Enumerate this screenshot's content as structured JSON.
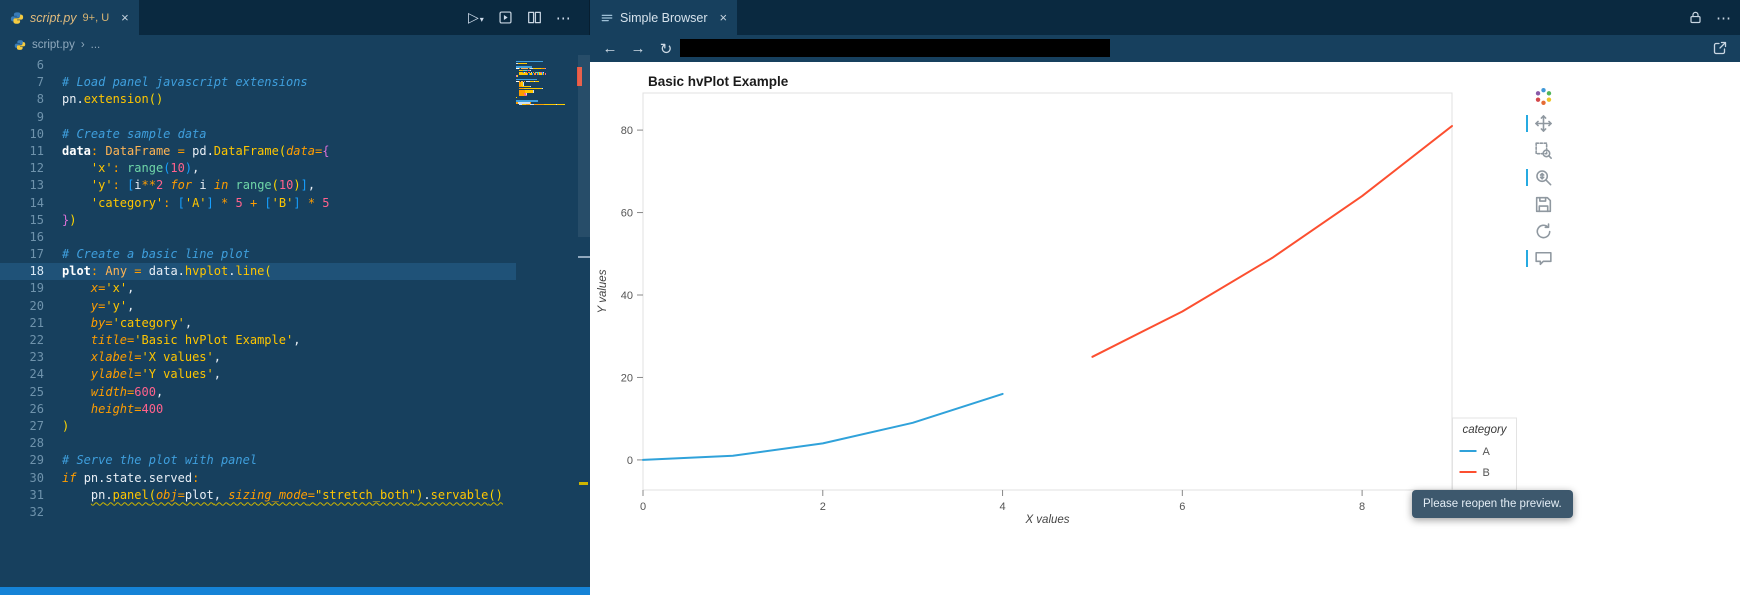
{
  "tabs": {
    "left": {
      "filename": "script.py",
      "decoration": "9+, U"
    },
    "right": {
      "label": "Simple Browser"
    }
  },
  "icons": {
    "play": "▷",
    "chevron_down": "▾",
    "close": "×",
    "more": "⋯",
    "back": "←",
    "forward": "→",
    "reload": "↻"
  },
  "breadcrumb": {
    "file": "script.py",
    "sep": "›",
    "more": "..."
  },
  "tooltip": {
    "message": "Please reopen the preview."
  },
  "bokeh_toolbar": {
    "active_tools": [
      "pan",
      "wheel-zoom",
      "hover"
    ],
    "active_color": "#26aae1"
  },
  "editor": {
    "lines": [
      {
        "n": 6,
        "tokens": []
      },
      {
        "n": 7,
        "tokens": [
          [
            "# Load panel javascript extensions",
            "com"
          ]
        ]
      },
      {
        "n": 8,
        "tokens": [
          [
            "pn",
            "pl"
          ],
          [
            ".",
            "pl"
          ],
          [
            "extension",
            "fn"
          ],
          [
            "()",
            "b1"
          ]
        ]
      },
      {
        "n": 9,
        "tokens": []
      },
      {
        "n": 10,
        "tokens": [
          [
            "# Create sample data",
            "com"
          ]
        ]
      },
      {
        "n": 11,
        "tokens": [
          [
            "data",
            "decl"
          ],
          [
            ":",
            "op"
          ],
          [
            " ",
            "pl"
          ],
          [
            "DataFrame",
            "typ"
          ],
          [
            " ",
            "pl"
          ],
          [
            "=",
            "op"
          ],
          [
            " ",
            "pl"
          ],
          [
            "pd",
            "pl"
          ],
          [
            ".",
            "pl"
          ],
          [
            "DataFrame",
            "fn"
          ],
          [
            "(",
            "b1"
          ],
          [
            "data",
            "prm"
          ],
          [
            "=",
            "op"
          ],
          [
            "{",
            "b2"
          ]
        ]
      },
      {
        "n": 12,
        "tokens": [
          [
            "    ",
            "pl"
          ],
          [
            "'x'",
            "str"
          ],
          [
            ":",
            "op"
          ],
          [
            " ",
            "pl"
          ],
          [
            "range",
            "bi"
          ],
          [
            "(",
            "b3"
          ],
          [
            "10",
            "num"
          ],
          [
            ")",
            "b3"
          ],
          [
            ",",
            "pl"
          ]
        ]
      },
      {
        "n": 13,
        "tokens": [
          [
            "    ",
            "pl"
          ],
          [
            "'y'",
            "str"
          ],
          [
            ":",
            "op"
          ],
          [
            " ",
            "pl"
          ],
          [
            "[",
            "b3"
          ],
          [
            "i",
            "pl"
          ],
          [
            "**",
            "op"
          ],
          [
            "2",
            "num"
          ],
          [
            " ",
            "pl"
          ],
          [
            "for",
            "kw"
          ],
          [
            " ",
            "pl"
          ],
          [
            "i",
            "pl"
          ],
          [
            " ",
            "pl"
          ],
          [
            "in",
            "kw"
          ],
          [
            " ",
            "pl"
          ],
          [
            "range",
            "bi"
          ],
          [
            "(",
            "b1"
          ],
          [
            "10",
            "num"
          ],
          [
            ")",
            "b1"
          ],
          [
            "]",
            "b3"
          ],
          [
            ",",
            "pl"
          ]
        ]
      },
      {
        "n": 14,
        "tokens": [
          [
            "    ",
            "pl"
          ],
          [
            "'category'",
            "str"
          ],
          [
            ":",
            "op"
          ],
          [
            " ",
            "pl"
          ],
          [
            "[",
            "b3"
          ],
          [
            "'A'",
            "str"
          ],
          [
            "]",
            "b3"
          ],
          [
            " ",
            "pl"
          ],
          [
            "*",
            "op"
          ],
          [
            " ",
            "pl"
          ],
          [
            "5",
            "num"
          ],
          [
            " ",
            "pl"
          ],
          [
            "+",
            "op"
          ],
          [
            " ",
            "pl"
          ],
          [
            "[",
            "b3"
          ],
          [
            "'B'",
            "str"
          ],
          [
            "]",
            "b3"
          ],
          [
            " ",
            "pl"
          ],
          [
            "*",
            "op"
          ],
          [
            " ",
            "pl"
          ],
          [
            "5",
            "num"
          ]
        ]
      },
      {
        "n": 15,
        "tokens": [
          [
            "}",
            "b2"
          ],
          [
            ")",
            "b1"
          ]
        ]
      },
      {
        "n": 16,
        "tokens": []
      },
      {
        "n": 17,
        "tokens": [
          [
            "# Create a basic line plot",
            "com"
          ]
        ]
      },
      {
        "n": 18,
        "hl": true,
        "tokens": [
          [
            "plot",
            "decl"
          ],
          [
            ":",
            "op"
          ],
          [
            " ",
            "pl"
          ],
          [
            "Any",
            "typ"
          ],
          [
            " ",
            "pl"
          ],
          [
            "=",
            "op"
          ],
          [
            " ",
            "pl"
          ],
          [
            "data",
            "pl"
          ],
          [
            ".",
            "pl"
          ],
          [
            "hvplot",
            "fn"
          ],
          [
            ".",
            "pl"
          ],
          [
            "line",
            "fn"
          ],
          [
            "(",
            "b1"
          ]
        ]
      },
      {
        "n": 19,
        "tokens": [
          [
            "    ",
            "pl"
          ],
          [
            "x",
            "prm"
          ],
          [
            "=",
            "op"
          ],
          [
            "'x'",
            "str"
          ],
          [
            ",",
            "pl"
          ]
        ]
      },
      {
        "n": 20,
        "tokens": [
          [
            "    ",
            "pl"
          ],
          [
            "y",
            "prm"
          ],
          [
            "=",
            "op"
          ],
          [
            "'y'",
            "str"
          ],
          [
            ",",
            "pl"
          ]
        ]
      },
      {
        "n": 21,
        "tokens": [
          [
            "    ",
            "pl"
          ],
          [
            "by",
            "prm"
          ],
          [
            "=",
            "op"
          ],
          [
            "'category'",
            "str"
          ],
          [
            ",",
            "pl"
          ]
        ]
      },
      {
        "n": 22,
        "tokens": [
          [
            "    ",
            "pl"
          ],
          [
            "title",
            "prm"
          ],
          [
            "=",
            "op"
          ],
          [
            "'Basic hvPlot Example'",
            "str"
          ],
          [
            ",",
            "pl"
          ]
        ]
      },
      {
        "n": 23,
        "tokens": [
          [
            "    ",
            "pl"
          ],
          [
            "xlabel",
            "prm"
          ],
          [
            "=",
            "op"
          ],
          [
            "'X values'",
            "str"
          ],
          [
            ",",
            "pl"
          ]
        ]
      },
      {
        "n": 24,
        "tokens": [
          [
            "    ",
            "pl"
          ],
          [
            "ylabel",
            "prm"
          ],
          [
            "=",
            "op"
          ],
          [
            "'Y values'",
            "str"
          ],
          [
            ",",
            "pl"
          ]
        ]
      },
      {
        "n": 25,
        "tokens": [
          [
            "    ",
            "pl"
          ],
          [
            "width",
            "prm"
          ],
          [
            "=",
            "op"
          ],
          [
            "600",
            "num"
          ],
          [
            ",",
            "pl"
          ]
        ]
      },
      {
        "n": 26,
        "tokens": [
          [
            "    ",
            "pl"
          ],
          [
            "height",
            "prm"
          ],
          [
            "=",
            "op"
          ],
          [
            "400",
            "num"
          ]
        ]
      },
      {
        "n": 27,
        "tokens": [
          [
            ")",
            "b1"
          ]
        ]
      },
      {
        "n": 28,
        "tokens": []
      },
      {
        "n": 29,
        "tokens": [
          [
            "# Serve the plot with panel",
            "com"
          ]
        ]
      },
      {
        "n": 30,
        "tokens": [
          [
            "if",
            "kw"
          ],
          [
            " ",
            "pl"
          ],
          [
            "pn",
            "pl"
          ],
          [
            ".",
            "pl"
          ],
          [
            "state",
            "pl"
          ],
          [
            ".",
            "pl"
          ],
          [
            "served",
            "pl"
          ],
          [
            ":",
            "op"
          ]
        ]
      },
      {
        "n": 31,
        "tokens": [
          [
            "    ",
            "pl"
          ],
          [
            "pn",
            "pl",
            1
          ],
          [
            ".",
            "pl",
            1
          ],
          [
            "panel",
            "fn",
            1
          ],
          [
            "(",
            "b1",
            1
          ],
          [
            "obj",
            "prm",
            1
          ],
          [
            "=",
            "op",
            1
          ],
          [
            "plot",
            "pl",
            1
          ],
          [
            ",",
            "pl",
            1
          ],
          [
            " ",
            "pl",
            1
          ],
          [
            "sizing_mode",
            "prm",
            1
          ],
          [
            "=",
            "op",
            1
          ],
          [
            "\"stretch_both\"",
            "str",
            1
          ],
          [
            ")",
            "b1",
            1
          ],
          [
            ".",
            "pl",
            1
          ],
          [
            "servable",
            "fn",
            1
          ],
          [
            "()",
            "b1",
            1
          ]
        ]
      },
      {
        "n": 32,
        "tokens": []
      }
    ]
  },
  "chart_data": {
    "type": "line",
    "title": "Basic hvPlot Example",
    "xlabel": "X values",
    "ylabel": "Y values",
    "xlim": [
      0,
      9
    ],
    "ylim": [
      -7.3,
      89
    ],
    "xticks": [
      0,
      2,
      4,
      6,
      8
    ],
    "yticks": [
      0,
      20,
      40,
      60,
      80
    ],
    "grid": false,
    "legend": {
      "title": "category",
      "position": "bottom_right_outside"
    },
    "series": [
      {
        "name": "A",
        "color": "#30a2da",
        "x": [
          0,
          1,
          2,
          3,
          4
        ],
        "y": [
          0,
          1,
          4,
          9,
          16
        ]
      },
      {
        "name": "B",
        "color": "#fc4f30",
        "x": [
          5,
          6,
          7,
          8,
          9
        ],
        "y": [
          25,
          36,
          49,
          64,
          81
        ]
      }
    ]
  }
}
